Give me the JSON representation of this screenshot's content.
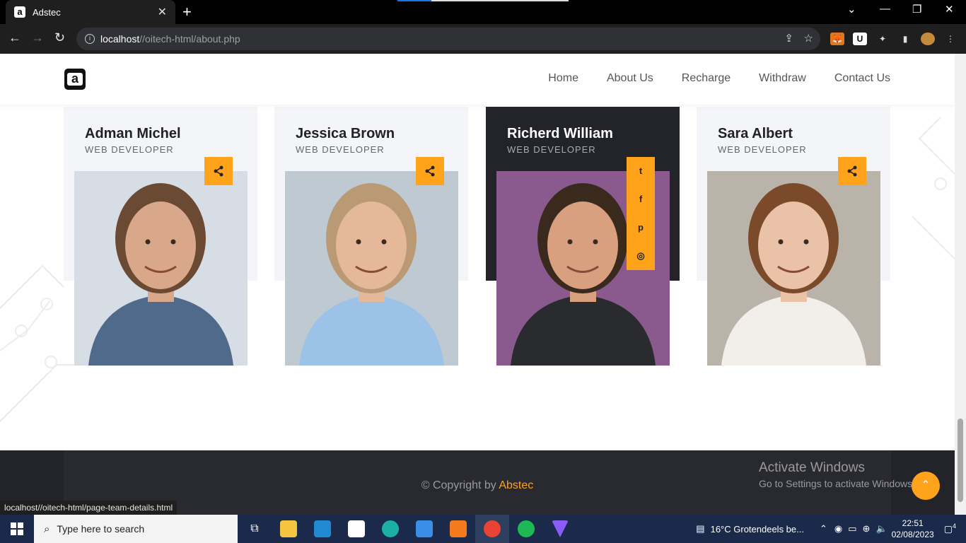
{
  "browser": {
    "tab_title": "Adstec",
    "tab_favicon": "a",
    "url_host": "localhost",
    "url_path": "//oitech-html/about.php",
    "status_url": "localhost//oitech-html/page-team-details.html"
  },
  "site": {
    "logo_letter": "a",
    "nav": [
      "Home",
      "About Us",
      "Recharge",
      "Withdraw",
      "Contact Us"
    ]
  },
  "team": [
    {
      "name": "Adman Michel",
      "role": "WEB DEVELOPER",
      "theme": "light",
      "skin": "#d9a88a",
      "hair": "#6b4a33",
      "shirt": "#4f6a8a",
      "bg": "#d7dde4"
    },
    {
      "name": "Jessica Brown",
      "role": "WEB DEVELOPER",
      "theme": "light",
      "skin": "#e6b89a",
      "hair": "#b99a74",
      "shirt": "#9cc2e8",
      "bg": "#bfc9d2"
    },
    {
      "name": "Richerd William",
      "role": "WEB DEVELOPER",
      "theme": "dark",
      "skin": "#d8a07e",
      "hair": "#3a2a1e",
      "shirt": "#2a2b2f",
      "bg": "#8a5a8e"
    },
    {
      "name": "Sara Albert",
      "role": "WEB DEVELOPER",
      "theme": "light",
      "skin": "#eac2a8",
      "hair": "#7a4a2a",
      "shirt": "#f2efea",
      "bg": "#b9b3aa"
    }
  ],
  "social_icons": [
    "twitter-icon",
    "facebook-icon",
    "pinterest-icon",
    "instagram-icon"
  ],
  "social_glyphs": [
    "t",
    "f",
    "p",
    "◎"
  ],
  "footer": {
    "copy_prefix": "© Copyright by",
    "brand": "Abstec"
  },
  "watermark": {
    "line1": "Activate Windows",
    "line2": "Go to Settings to activate Windows."
  },
  "taskbar": {
    "search_placeholder": "Type here to search",
    "weather": "16°C  Grotendeels be...",
    "time": "22:51",
    "date": "02/08/2023",
    "notifications": "4"
  },
  "colors": {
    "accent": "#ffa31a",
    "dark_card": "#23242a",
    "light_card": "#f4f5f8"
  }
}
